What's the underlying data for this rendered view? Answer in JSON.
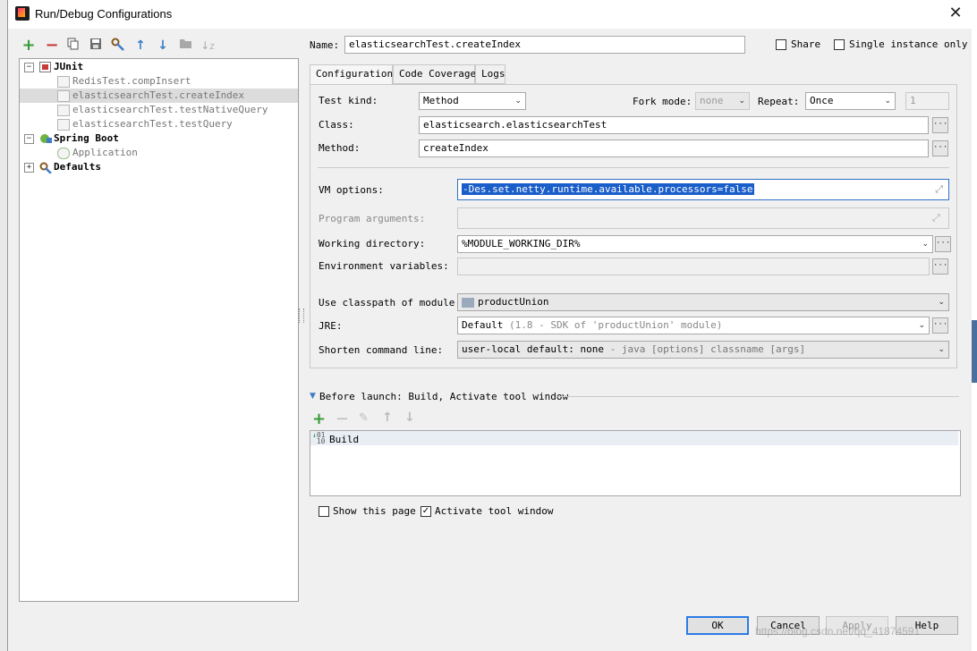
{
  "window": {
    "title": "Run/Debug Configurations"
  },
  "tree": {
    "junit_label": "JUnit",
    "junit_items": [
      "RedisTest.compInsert",
      "elasticsearchTest.createIndex",
      "elasticsearchTest.testNativeQuery",
      "elasticsearchTest.testQuery"
    ],
    "spring_boot_label": "Spring Boot",
    "spring_boot_items": [
      "Application"
    ],
    "defaults_label": "Defaults",
    "selected_item": "elasticsearchTest.createIndex"
  },
  "header": {
    "name_label": "Name:",
    "name_value": "elasticsearchTest.createIndex",
    "share_label": "Share",
    "share_checked": false,
    "single_instance_label": "Single instance only",
    "single_instance_checked": false
  },
  "tabs": [
    "Configuration",
    "Code Coverage",
    "Logs"
  ],
  "active_tab": "Configuration",
  "config": {
    "test_kind_label": "Test kind:",
    "test_kind_value": "Method",
    "fork_mode_label": "Fork mode:",
    "fork_mode_value": "none",
    "repeat_label": "Repeat:",
    "repeat_value": "Once",
    "repeat_count": "1",
    "class_label": "Class:",
    "class_value": "elasticsearch.elasticsearchTest",
    "method_label": "Method:",
    "method_value": "createIndex",
    "vm_options_label": "VM options:",
    "vm_options_value": "-Des.set.netty.runtime.available.processors=false",
    "program_args_label": "Program arguments:",
    "program_args_value": "",
    "working_dir_label": "Working directory:",
    "working_dir_value": "%MODULE_WORKING_DIR%",
    "env_vars_label": "Environment variables:",
    "env_vars_value": "",
    "classpath_label": "Use classpath of module:",
    "classpath_value": "productUnion",
    "jre_label": "JRE:",
    "jre_value": "Default",
    "jre_hint": "(1.8 - SDK of 'productUnion' module)",
    "shorten_label": "Shorten command line:",
    "shorten_value": "user-local default: none",
    "shorten_hint": "- java [options] classname [args]"
  },
  "before_launch": {
    "label": "Before launch: Build, Activate tool window",
    "items": [
      "Build"
    ]
  },
  "bottom": {
    "show_page_label": "Show this page",
    "show_page_checked": false,
    "activate_label": "Activate tool window",
    "activate_checked": true
  },
  "buttons": {
    "ok": "OK",
    "cancel": "Cancel",
    "apply": "Apply",
    "help": "Help"
  },
  "watermark": "https://blog.csdn.net/qq_41874591",
  "colors": {
    "selection": "#1a5ec9",
    "add_green": "#3a9a3a",
    "remove_red": "#c83a3a",
    "nav_blue": "#3d7cc9"
  }
}
